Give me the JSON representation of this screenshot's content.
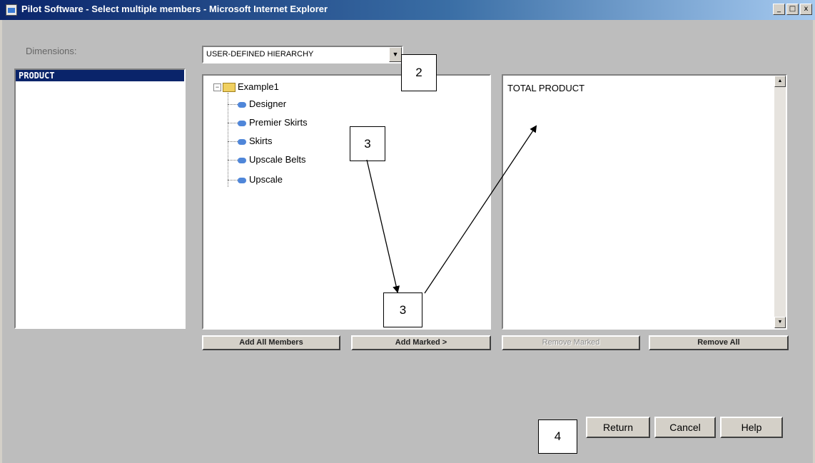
{
  "window": {
    "title": "Pilot Software - Select multiple members - Microsoft Internet Explorer",
    "minimize_glyph": "_",
    "maximize_glyph": "□",
    "close_glyph": "x"
  },
  "dimensions": {
    "label": "Dimensions:",
    "items": [
      "PRODUCT"
    ],
    "selected": "PRODUCT"
  },
  "hierarchy_select": {
    "value": "USER-DEFINED HIERARCHY",
    "arrow": "▼"
  },
  "member_tree": {
    "root": "Example1",
    "expander": "−",
    "children": [
      "Designer",
      "Premier Skirts",
      "Skirts",
      "Upscale Belts",
      "Upscale"
    ]
  },
  "selected_members": {
    "items": [
      "TOTAL PRODUCT"
    ],
    "scroll_up": "▲",
    "scroll_down": "▼"
  },
  "member_buttons": {
    "add_all": "Add All Members",
    "add_marked": "Add Marked >",
    "remove_marked": "Remove Marked",
    "remove_all": "Remove All"
  },
  "dialog_buttons": {
    "return": "Return",
    "cancel": "Cancel",
    "help": "Help"
  },
  "callouts": {
    "hierarchy": "2",
    "tree": "3",
    "add_marked": "3",
    "return": "4"
  }
}
